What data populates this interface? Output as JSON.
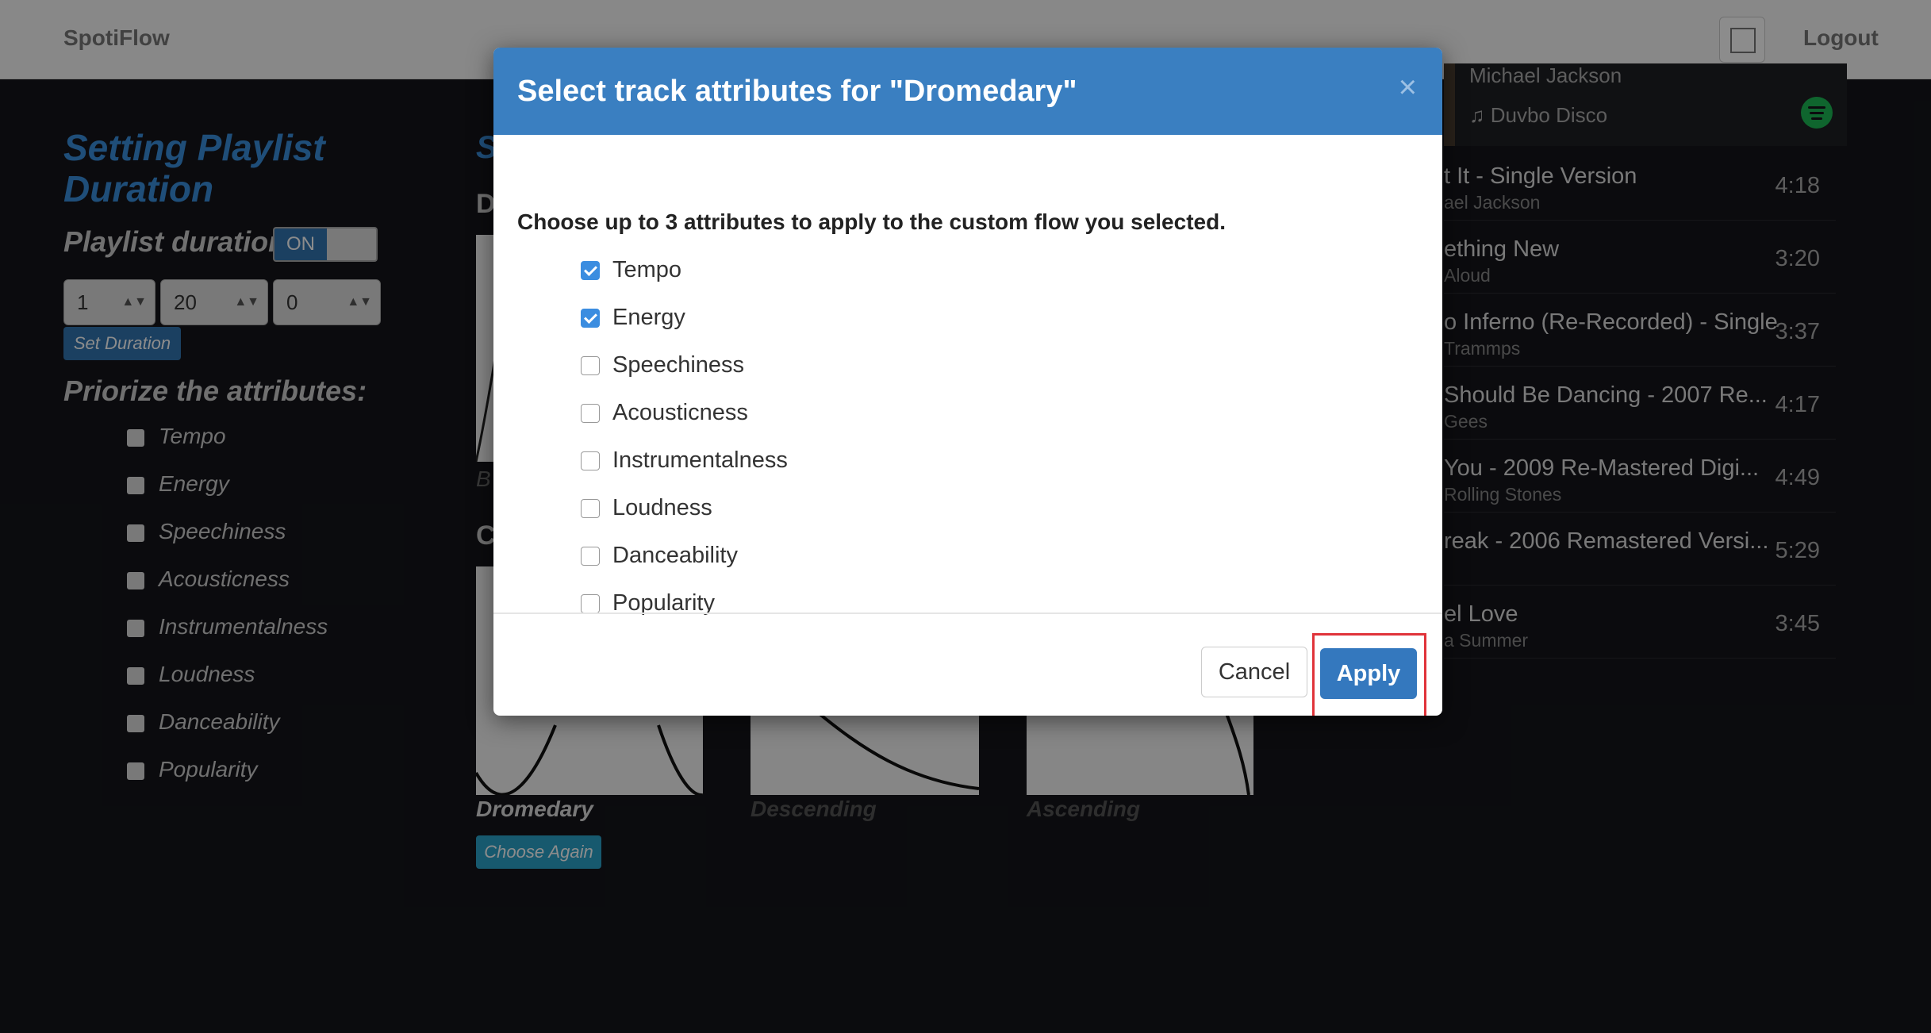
{
  "navbar": {
    "brand": "SpotiFlow",
    "logout": "Logout"
  },
  "left": {
    "duration_heading": "Setting Playlist Duration",
    "duration_label": "Playlist duration:",
    "toggle_on": "ON",
    "selects": [
      "1",
      "20",
      "0"
    ],
    "set_duration": "Set Duration",
    "priorize_heading": "Priorize the attributes:",
    "attributes": [
      "Tempo",
      "Energy",
      "Speechiness",
      "Acousticness",
      "Instrumentalness",
      "Loudness",
      "Danceability",
      "Popularity"
    ]
  },
  "middle": {
    "heading_top": "S",
    "sub_top": "D",
    "partial_label": "B",
    "heading_mid": "C",
    "flows": [
      "Dromedary",
      "Descending",
      "Ascending"
    ],
    "choose_again": "Choose Again"
  },
  "tracklist": {
    "header_artist": "Michael Jackson",
    "header_album": "Duvbo Disco",
    "tracks": [
      {
        "title": "t It - Single Version",
        "artist": "ael Jackson",
        "duration": "4:18"
      },
      {
        "title": "ething New",
        "artist": "Aloud",
        "duration": "3:20"
      },
      {
        "title": "o Inferno (Re-Recorded) - Single",
        "artist": "Trammps",
        "duration": "3:37"
      },
      {
        "title": "Should Be Dancing - 2007 Re...",
        "artist": "Gees",
        "duration": "4:17"
      },
      {
        "title": "You - 2009 Re-Mastered Digi...",
        "artist": "Rolling Stones",
        "duration": "4:49"
      },
      {
        "title": "reak - 2006 Remastered Versi...",
        "artist": "",
        "duration": "5:29"
      },
      {
        "title": "el Love",
        "artist": "a Summer",
        "duration": "3:45"
      }
    ]
  },
  "modal": {
    "title": "Select track attributes for \"Dromedary\"",
    "close": "×",
    "description": "Choose up to 3 attributes to apply to the custom flow you selected.",
    "attributes": [
      {
        "label": "Tempo",
        "checked": true
      },
      {
        "label": "Energy",
        "checked": true
      },
      {
        "label": "Speechiness",
        "checked": false
      },
      {
        "label": "Acousticness",
        "checked": false
      },
      {
        "label": "Instrumentalness",
        "checked": false
      },
      {
        "label": "Loudness",
        "checked": false
      },
      {
        "label": "Danceability",
        "checked": false
      },
      {
        "label": "Popularity",
        "checked": false
      }
    ],
    "cancel": "Cancel",
    "apply": "Apply"
  },
  "colors": {
    "primary": "#3478be",
    "header": "#3a7fc1",
    "highlight": "#e0333a",
    "spotify": "#1db954"
  }
}
